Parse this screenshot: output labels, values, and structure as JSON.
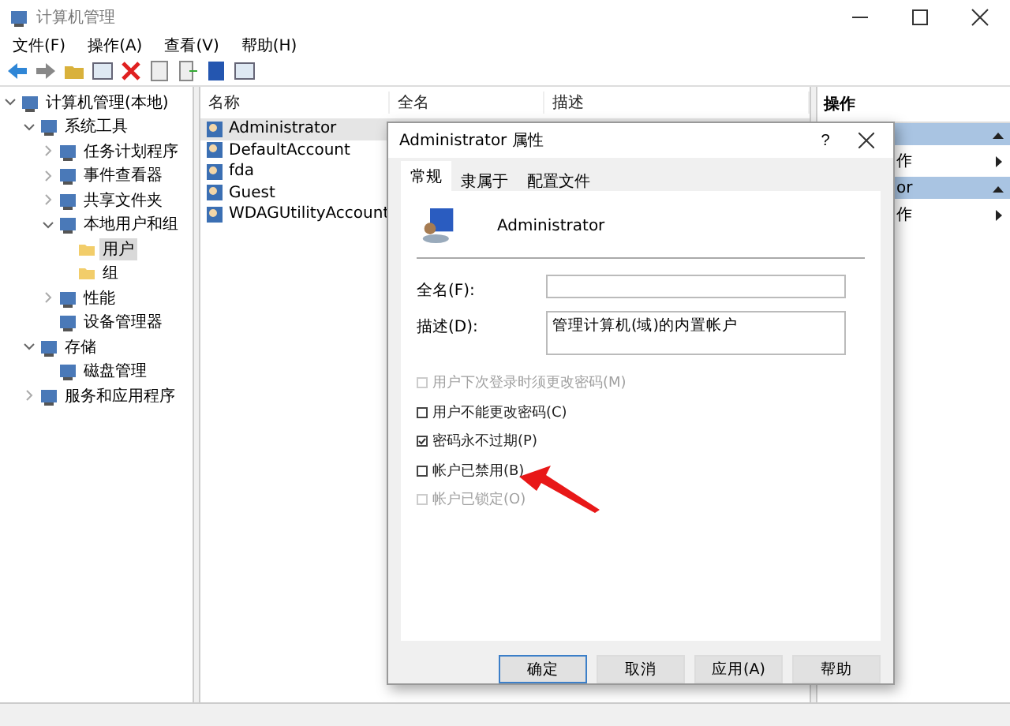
{
  "window": {
    "title": "计算机管理"
  },
  "menu": [
    {
      "label": "文件(F)"
    },
    {
      "label": "操作(A)"
    },
    {
      "label": "查看(V)"
    },
    {
      "label": "帮助(H)"
    }
  ],
  "tree": [
    {
      "label": "计算机管理(本地)",
      "kind": "group",
      "expanded": true,
      "selected": false,
      "children": [
        {
          "label": "系统工具",
          "kind": "group",
          "expanded": true,
          "selected": false,
          "children": [
            {
              "label": "任务计划程序",
              "kind": "group",
              "expanded": false,
              "selected": false
            },
            {
              "label": "事件查看器",
              "kind": "group",
              "expanded": false,
              "selected": false
            },
            {
              "label": "共享文件夹",
              "kind": "group",
              "expanded": false,
              "selected": false
            },
            {
              "label": "本地用户和组",
              "kind": "group",
              "expanded": true,
              "selected": false,
              "children": [
                {
                  "label": "用户",
                  "kind": "leaf",
                  "selected": true
                },
                {
                  "label": "组",
                  "kind": "leaf",
                  "selected": false
                }
              ]
            },
            {
              "label": "性能",
              "kind": "group",
              "expanded": false,
              "selected": false
            },
            {
              "label": "设备管理器",
              "kind": "leaf",
              "selected": false
            }
          ]
        },
        {
          "label": "存储",
          "kind": "group",
          "expanded": true,
          "selected": false,
          "children": [
            {
              "label": "磁盘管理",
              "kind": "leaf",
              "selected": false
            }
          ]
        },
        {
          "label": "服务和应用程序",
          "kind": "group",
          "expanded": false,
          "selected": false
        }
      ]
    }
  ],
  "table": {
    "columns": [
      "名称",
      "全名",
      "描述"
    ],
    "rows": [
      {
        "name": "Administrator",
        "selected": true
      },
      {
        "name": "DefaultAccount",
        "selected": false
      },
      {
        "name": "fda",
        "selected": false
      },
      {
        "name": "Guest",
        "selected": false
      },
      {
        "name": "WDAGUtilityAccount",
        "selected": false
      }
    ]
  },
  "actions": {
    "title": "操作",
    "sections": [
      {
        "item": "作"
      },
      {
        "header": "or",
        "item": "作"
      }
    ]
  },
  "dialog": {
    "title": "Administrator 属性",
    "help": "?",
    "tabs": [
      {
        "label": "常规",
        "selected": true
      },
      {
        "label": "隶属于",
        "selected": false
      },
      {
        "label": "配置文件",
        "selected": false
      }
    ],
    "user": "Administrator",
    "fields": [
      {
        "label": "全名(F):"
      },
      {
        "label": "描述(D):",
        "value": "管理计算机(域)的内置帐户"
      }
    ],
    "options": [
      {
        "label": "用户下次登录时须更改密码(M)",
        "checked": false,
        "disabled": true
      },
      {
        "label": "用户不能更改密码(C)",
        "checked": false,
        "disabled": false
      },
      {
        "label": "密码永不过期(P)",
        "checked": true,
        "disabled": false
      },
      {
        "label": "帐户已禁用(B)",
        "checked": false,
        "disabled": false
      },
      {
        "label": "帐户已锁定(O)",
        "checked": false,
        "disabled": true
      }
    ],
    "buttons": [
      {
        "label": "确定",
        "default": true
      },
      {
        "label": "取消",
        "default": false
      },
      {
        "label": "应用(A)",
        "default": false
      },
      {
        "label": "帮助",
        "default": false
      }
    ]
  }
}
